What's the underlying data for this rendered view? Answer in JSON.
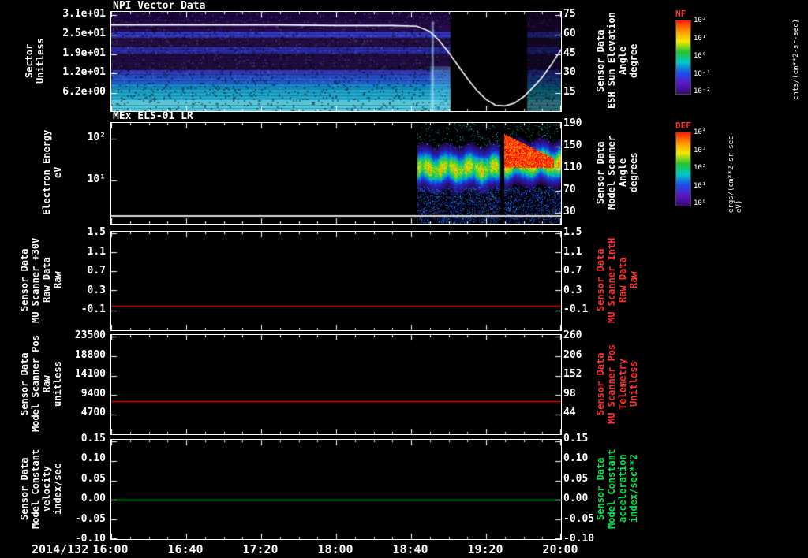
{
  "figure": {
    "date_label": "2014/132",
    "x_ticks": [
      "16:00",
      "16:40",
      "17:20",
      "18:00",
      "18:40",
      "19:20",
      "20:00"
    ]
  },
  "panels": [
    {
      "title": "NPI Vector Data",
      "left_label_lines": [
        "Sector",
        "Unitless"
      ],
      "left_ticks": [
        "3.1e+01",
        "2.5e+01",
        "1.9e+01",
        "1.2e+01",
        "6.2e+00"
      ],
      "right_ticks": [
        "75",
        "60",
        "45",
        "30",
        "15"
      ],
      "right_label_lines": [
        "Sensor Data",
        "ESH Sun Elevation",
        "Angle",
        "degree"
      ],
      "right_label_color": "#ffffff"
    },
    {
      "title": "MEx ELS-01 LR",
      "left_label_lines": [
        "Electron Energy",
        "eV"
      ],
      "left_ticks": [
        "10²",
        "10¹"
      ],
      "right_ticks": [
        "190",
        "150",
        "110",
        "70",
        "30"
      ],
      "right_label_lines": [
        "Sensor Data",
        "Model Scanner",
        "Angle",
        "degrees"
      ],
      "right_label_color": "#ffffff"
    },
    {
      "left_label_lines": [
        "Sensor Data",
        "MU Scanner +30V",
        "Raw Data",
        "Raw"
      ],
      "left_ticks": [
        "1.5",
        "1.1",
        "0.7",
        "0.3",
        "-0.1"
      ],
      "right_ticks": [
        "1.5",
        "1.1",
        "0.7",
        "0.3",
        "-0.1"
      ],
      "right_label_lines": [
        "Sensor Data",
        "MU Scanner IntH",
        "Raw Data",
        "Raw"
      ],
      "right_label_color": "#ff3030"
    },
    {
      "left_label_lines": [
        "Sensor Data",
        "Model Scanner Pos",
        "Raw",
        "unitless"
      ],
      "left_ticks": [
        "23500",
        "18800",
        "14100",
        "9400",
        "4700"
      ],
      "right_ticks": [
        "260",
        "206",
        "152",
        "98",
        "44"
      ],
      "right_label_lines": [
        "Sensor Data",
        "MU Scanner Pos",
        "Telemetry",
        "Unitless"
      ],
      "right_label_color": "#ff3030"
    },
    {
      "left_label_lines": [
        "Sensor Data",
        "Model Constant",
        "velocity",
        "index/sec"
      ],
      "left_ticks": [
        "0.15",
        "0.10",
        "0.05",
        "0.00",
        "-0.05",
        "-0.10"
      ],
      "right_ticks": [
        "0.15",
        "0.10",
        "0.05",
        "0.00",
        "-0.05",
        "-0.10"
      ],
      "right_label_lines": [
        "Sensor Data",
        "Model Constant",
        "acceleration",
        "index/sec**2"
      ],
      "right_label_color": "#00e650"
    }
  ],
  "colorbars": [
    {
      "title": "NF",
      "title_color": "#ff3030",
      "ticks": [
        "10²",
        "10¹",
        "10⁰",
        "10⁻¹",
        "10⁻²"
      ],
      "units": "cnts/(cm**2-sr-sec)",
      "colormap": [
        "#ff1a00",
        "#ff9500",
        "#f2e800",
        "#25c430",
        "#00c8c8",
        "#1b50e8",
        "#5a18c8",
        "#3a0a70"
      ]
    },
    {
      "title": "DEF",
      "title_color": "#ff3030",
      "ticks": [
        "10⁴",
        "10³",
        "10²",
        "10¹",
        "10⁰"
      ],
      "units": "ergs/(cm**2-sr-sec-eV)",
      "colormap": [
        "#ff1a00",
        "#ff9500",
        "#f2e800",
        "#25c430",
        "#00c8c8",
        "#1b50e8",
        "#5a18c8",
        "#3a0a70"
      ]
    }
  ],
  "chart_data": [
    {
      "type": "heatmap",
      "render": "npi",
      "title": "NPI Vector Data",
      "ylabel": "Sector (Unitless)",
      "y_ticks": [
        31,
        25,
        19,
        12,
        6.2
      ],
      "x_minutes": 240,
      "x_start": "16:00",
      "x_end": "20:00",
      "left_tick_fracs": [
        0.032,
        0.228,
        0.425,
        0.622,
        0.818
      ],
      "right_tick_fracs": [
        0.032,
        0.228,
        0.425,
        0.622,
        0.818
      ],
      "bands": [
        {
          "y0": 0.0,
          "y1": 0.09,
          "color": "#1e0742"
        },
        {
          "y0": 0.09,
          "y1": 0.2,
          "color": "#270a4e"
        },
        {
          "y0": 0.2,
          "y1": 0.26,
          "color": "#3336bd"
        },
        {
          "y0": 0.26,
          "y1": 0.36,
          "color": "#230e46"
        },
        {
          "y0": 0.36,
          "y1": 0.42,
          "color": "#2b2ba6"
        },
        {
          "y0": 0.42,
          "y1": 0.59,
          "color": "#200c44"
        },
        {
          "y0": 0.59,
          "y1": 0.65,
          "color": "#2e3fbe"
        },
        {
          "y0": 0.65,
          "y1": 0.72,
          "color": "#2456cc"
        },
        {
          "y0": 0.72,
          "y1": 0.78,
          "color": "#1186cc"
        },
        {
          "y0": 0.78,
          "y1": 0.89,
          "color": "#1fa9cf"
        },
        {
          "y0": 0.89,
          "y1": 1.0,
          "color": "#55c9dd"
        }
      ],
      "gap_minutes": [
        181,
        222
      ],
      "burst_minutes": [
        170,
        181
      ],
      "overlay_line": {
        "name": "Sensor Data ESH Sun Elevation Angle (degree)",
        "color": "#ffffff",
        "ylim": [
          1,
          77
        ],
        "points": [
          [
            0,
            67
          ],
          [
            30,
            67
          ],
          [
            60,
            67
          ],
          [
            90,
            67
          ],
          [
            120,
            66.5
          ],
          [
            150,
            66.5
          ],
          [
            163,
            66
          ],
          [
            170,
            62
          ],
          [
            175,
            55
          ],
          [
            180,
            46
          ],
          [
            185,
            36
          ],
          [
            190,
            26
          ],
          [
            195,
            17
          ],
          [
            200,
            10
          ],
          [
            205,
            5.5
          ],
          [
            210,
            5
          ],
          [
            215,
            7
          ],
          [
            220,
            12
          ],
          [
            225,
            19
          ],
          [
            230,
            27
          ],
          [
            235,
            37
          ],
          [
            240,
            48
          ]
        ]
      }
    },
    {
      "type": "heatmap",
      "render": "els",
      "title": "MEx ELS-01 LR",
      "ylabel": "Electron Energy (eV)",
      "yscale": "log",
      "ylog_top": 2.38,
      "ylog_bottom": -0.04,
      "x_minutes": 240,
      "data_start_minute": 163,
      "gap_minutes": [
        207.5,
        209.5
      ],
      "beam": {
        "center_log": 1.3,
        "sigma": 0.24,
        "amp_pre": 0.68,
        "amp_post": 0.74
      },
      "red_wedge": {
        "minutes": [
          209.5,
          236
        ],
        "log_low": 1.32,
        "log_top_start": 2.12,
        "log_top_slope": -0.022,
        "value": 0.93
      },
      "bottom_line": {
        "yfrac": 0.914,
        "color": "#d8d8d8"
      },
      "left_tick_fracs": [
        0.156,
        0.57
      ],
      "right_tick_fracs": [
        0.016,
        0.234,
        0.453,
        0.672,
        0.891
      ],
      "right_axis_ticks": [
        190,
        150,
        110,
        70,
        30
      ],
      "colormap": [
        [
          0,
          "#08041e"
        ],
        [
          0.1,
          "#2d0f78"
        ],
        [
          0.22,
          "#1e28c8"
        ],
        [
          0.34,
          "#0a6edc"
        ],
        [
          0.45,
          "#00bebe"
        ],
        [
          0.55,
          "#1ec846"
        ],
        [
          0.66,
          "#96dc14"
        ],
        [
          0.76,
          "#f0e600"
        ],
        [
          0.85,
          "#ffa000"
        ],
        [
          0.93,
          "#ff5000"
        ],
        [
          1,
          "#ff0000"
        ]
      ]
    },
    {
      "type": "line",
      "render": "line",
      "x_minutes": 240,
      "series": [
        {
          "name": "MU Scanner +30V Raw Data",
          "color": "#e80000",
          "value": 0.0
        }
      ],
      "ylim_ticks": {
        "values": [
          1.5,
          1.1,
          0.7,
          0.3,
          -0.1
        ],
        "fracs": [
          0.016,
          0.208,
          0.4,
          0.592,
          0.8
        ]
      }
    },
    {
      "type": "line",
      "render": "line",
      "x_minutes": 240,
      "series": [
        {
          "name": "Model Scanner Pos Raw",
          "color": "#e80000",
          "value": 7960
        }
      ],
      "ylim_ticks": {
        "values": [
          23500,
          18800,
          14100,
          9400,
          4700
        ],
        "fracs": [
          0.016,
          0.212,
          0.409,
          0.605,
          0.802
        ]
      },
      "right_axis_ticks": [
        260,
        206,
        152,
        98,
        44
      ]
    },
    {
      "type": "line",
      "render": "line",
      "x_minutes": 240,
      "series": [
        {
          "name": "Model Constant velocity",
          "color": "#00c040",
          "value": 0.0
        }
      ],
      "ylim_ticks": {
        "values": [
          0.15,
          0.1,
          0.05,
          0.0,
          -0.05,
          -0.1
        ],
        "fracs": [
          0.016,
          0.213,
          0.41,
          0.607,
          0.803,
          0.99
        ]
      }
    }
  ]
}
